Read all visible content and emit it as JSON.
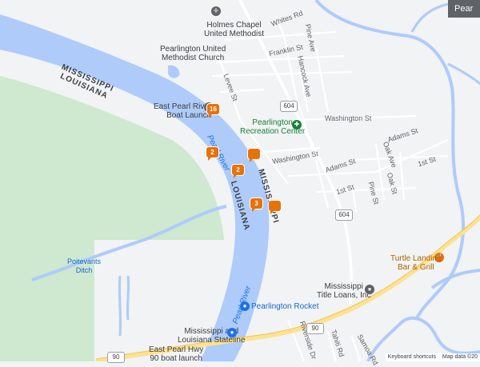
{
  "map": {
    "colors": {
      "land": "#f1f3f4",
      "water": "#aecbfa",
      "park": "#cfe8d0",
      "road": "#ffffff",
      "highway": "#fde293",
      "marker": "#e8710a"
    },
    "top_button": "Pear",
    "places": {
      "holmes": "Holmes Chapel\nUnited Methodist",
      "pearlington_umc": "Pearlington United\nMethodist Church",
      "boat_launch": "East Pearl River\nBoat Launch",
      "recreation": "Pearlington\nRecreation Center",
      "turtle": "Turtle Landing\nBar & Grill",
      "title_loans": "Mississippi\nTitle Loans, Inc",
      "rocket": "Pearlington Rocket",
      "stateline": "Mississippi and\nLouisiana Stateline",
      "hwy_launch": "East Pearl Hwy\n90 boat launch"
    },
    "states": {
      "ms_la_top": "MISSISSIPPI\nLOUISIANA",
      "ms_mid": "MISSISSIPPI",
      "la_mid": "LOUISIANA"
    },
    "rivers": {
      "pearl_top": "Pearl River",
      "pearl_bottom": "Pearl River"
    },
    "water": {
      "ditch": "Poitevants\nDitch"
    },
    "streets": {
      "whites": "Whites Rd",
      "franklin": "Franklin St",
      "pine_top": "Pine Ave",
      "hancock": "Hancock Ave",
      "levee": "Levee St",
      "washington_east": "Washington St",
      "washington_west": "Washington St",
      "adams_east": "Adams St",
      "adams_west": "Adams St",
      "oak": "Oak Ave",
      "first_east": "1st St",
      "first_west": "1st St",
      "oak_st": "Oak St",
      "pine_lower": "Pine St",
      "riverside": "Riverside Dr",
      "tahiti": "Tahiti Rd",
      "samoa": "Samoa Rd"
    },
    "shields": {
      "r604_top": "604",
      "r604_bottom": "604",
      "us90_mid": "90",
      "us90_left": "90"
    },
    "markers": [
      "16",
      "2",
      "2",
      "3",
      "",
      ""
    ],
    "attribution": {
      "shortcuts": "Keyboard shortcuts",
      "data": "Map data ©20"
    }
  }
}
